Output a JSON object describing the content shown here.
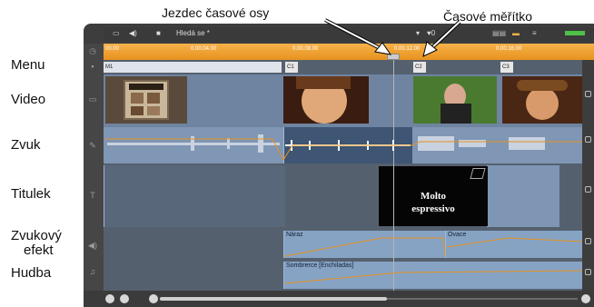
{
  "callouts": {
    "scrubber": "Jezdec časové osy",
    "time_scale": "Časové měřítko"
  },
  "track_labels": {
    "menu": "Menu",
    "video": "Video",
    "audio": "Zvuk",
    "title": "Titulek",
    "sfx_line1": "Zvukový",
    "sfx_line2": "efekt",
    "music": "Hudba"
  },
  "toolbar": {
    "search": "Hledá se *"
  },
  "ruler": {
    "ticks": [
      "00.00",
      "0.00.04.00",
      "0.00.08.00",
      "0.00.12.00",
      "0.00.16.00"
    ]
  },
  "markers": {
    "m1": "M1",
    "c1": "C1",
    "c2": "C2",
    "c3": "C3"
  },
  "title_clip": {
    "line1": "Molto",
    "line2": "espressivo"
  },
  "sfx_clips": {
    "first": "Náraz",
    "second": "Ovace"
  },
  "music_clip": {
    "label": "Sombrerce [Enchiladas]"
  },
  "colors": {
    "ruler": "#e8921e",
    "clip": "#86a3c4",
    "track": "#5f6b7a",
    "frame": "#3d3d3d"
  }
}
